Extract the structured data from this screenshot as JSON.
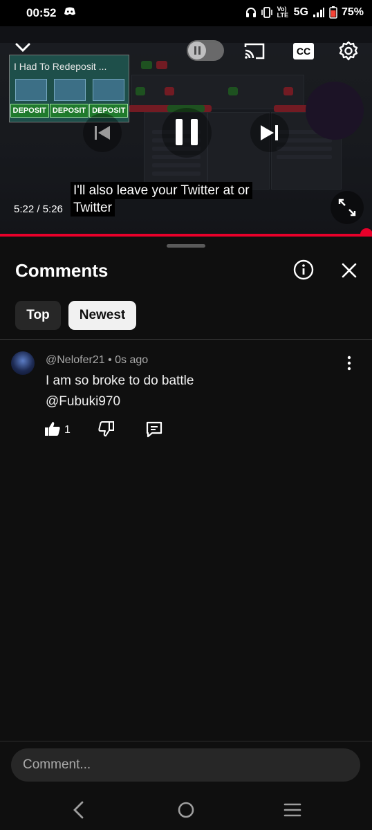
{
  "status_bar": {
    "time": "00:52",
    "network_label": "5G",
    "volte_label": "Vo) LTE",
    "battery": "75%",
    "icons": [
      "discord-icon",
      "headphones-icon",
      "vibrate-icon",
      "volte-icon",
      "signal-icon",
      "battery-icon"
    ]
  },
  "player": {
    "thumbnail_title": "I Had To Redeposit ...",
    "thumbnail_badges": [
      "DEPOSIT",
      "DEPOSIT",
      "DEPOSIT"
    ],
    "cc_label": "CC",
    "caption_lines": [
      "I'll also leave your Twitter at or",
      "Twitter"
    ],
    "timecode": "5:22 / 5:26",
    "progress_fraction": 0.985,
    "accent_color": "#e8002a"
  },
  "comments_sheet": {
    "title": "Comments",
    "tabs": [
      {
        "label": "Top",
        "selected": false
      },
      {
        "label": "Newest",
        "selected": true
      }
    ],
    "comments": [
      {
        "author": "@Nelofer21",
        "age": "0s ago",
        "meta": "@Nelofer21 • 0s ago",
        "text": "I am so broke to do battle\n@Fubuki970",
        "likes": "1"
      }
    ]
  },
  "composer": {
    "placeholder": "Comment..."
  }
}
